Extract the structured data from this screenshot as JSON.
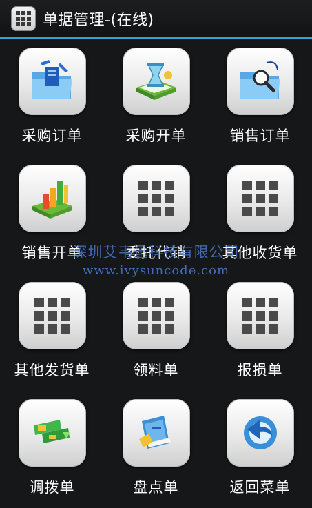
{
  "titlebar": {
    "icon": "grid-app-icon",
    "title": "单据管理-(在线)"
  },
  "accent_color": "#2ea3d6",
  "tiles": [
    {
      "label": "采购订单",
      "icon": "purchase-order-icon"
    },
    {
      "label": "采购开单",
      "icon": "purchase-billing-icon"
    },
    {
      "label": "销售订单",
      "icon": "sales-order-icon"
    },
    {
      "label": "销售开单",
      "icon": "sales-billing-chart-icon"
    },
    {
      "label": "委托代销",
      "icon": "grid-icon"
    },
    {
      "label": "其他收货单",
      "icon": "grid-icon"
    },
    {
      "label": "其他发货单",
      "icon": "grid-icon"
    },
    {
      "label": "领料单",
      "icon": "grid-icon"
    },
    {
      "label": "报损单",
      "icon": "grid-icon"
    },
    {
      "label": "调拨单",
      "icon": "transfer-icon"
    },
    {
      "label": "盘点单",
      "icon": "inventory-book-icon"
    },
    {
      "label": "返回菜单",
      "icon": "return-arrow-icon"
    }
  ],
  "watermark": {
    "line1": "深圳艾韦迅科技有限公司",
    "line2": "www.ivysuncode.com"
  }
}
